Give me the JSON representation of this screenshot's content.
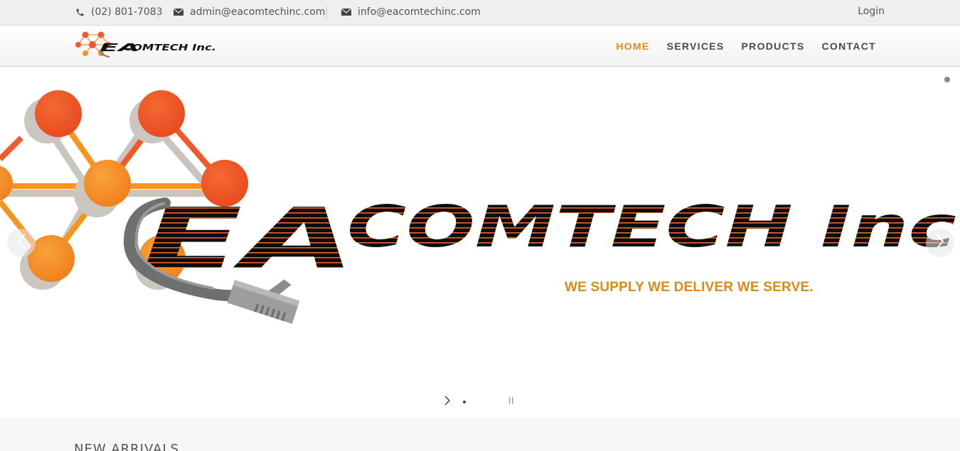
{
  "topbar": {
    "phone": "(02) 801-7083",
    "email_admin": "admin@eacomtechinc.com",
    "email_info": "info@eacomtechinc.com",
    "login_label": "Login"
  },
  "header": {
    "logo_text": "EACOMTECH Inc.",
    "nav": [
      {
        "label": "HOME",
        "active": true
      },
      {
        "label": "SERVICES",
        "active": false
      },
      {
        "label": "PRODUCTS",
        "active": false
      },
      {
        "label": "CONTACT",
        "active": false
      }
    ]
  },
  "hero": {
    "brand_text": "EACOMTECH Inc.",
    "tagline": "WE SUPPLY WE DELIVER WE SERVE."
  },
  "section": {
    "title": "NEW ARRIVALS"
  },
  "colors": {
    "accent": "#e08a1e",
    "tagline": "#d98a17",
    "node_orange": "#f0572a",
    "node_light": "#f7941d",
    "topbar_bg": "#efefef"
  },
  "icons": {
    "phone": "phone-icon",
    "mail": "mail-icon",
    "prev": "chevron-left-icon",
    "next": "chevron-right-icon",
    "pause": "pause-icon"
  }
}
